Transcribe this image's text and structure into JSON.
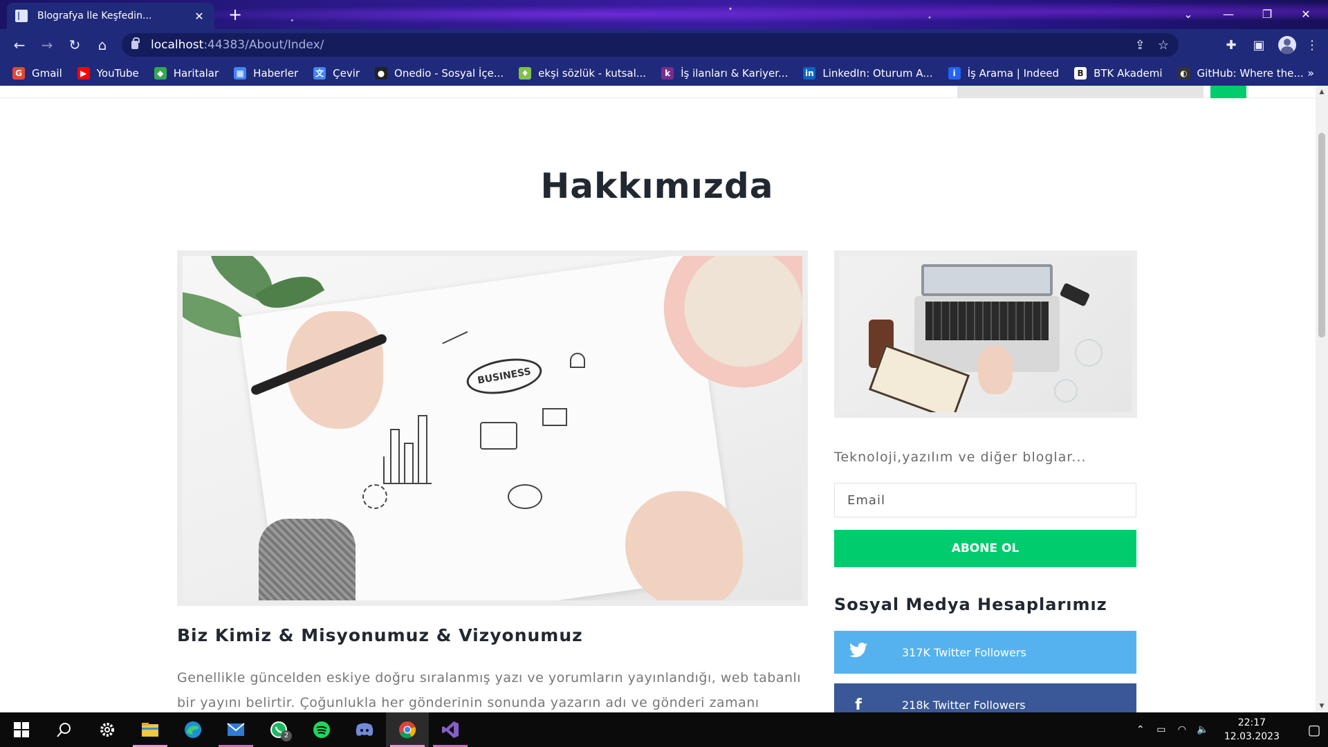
{
  "browser": {
    "tab_title": "Blografya İle Keşfedin...",
    "tab_close": "✕",
    "new_tab": "+",
    "url_host": "localhost",
    "url_rest": ":44383/About/Index/",
    "bookmarks": [
      {
        "label": "Gmail",
        "icon": "G",
        "color": "#ea4335"
      },
      {
        "label": "YouTube",
        "icon": "▶",
        "color": "#ff0000"
      },
      {
        "label": "Haritalar",
        "icon": "◆",
        "color": "#34a853"
      },
      {
        "label": "Haberler",
        "icon": "▦",
        "color": "#4285f4"
      },
      {
        "label": "Çevir",
        "icon": "文",
        "color": "#4285f4"
      },
      {
        "label": "Onedio - Sosyal İçe...",
        "icon": "●",
        "color": "#222222"
      },
      {
        "label": "ekşi sözlük - kutsal...",
        "icon": "♦",
        "color": "#81c14b"
      },
      {
        "label": "İş ilanları & Kariyer...",
        "icon": "k",
        "color": "#7b2c8e"
      },
      {
        "label": "LinkedIn: Oturum A...",
        "icon": "in",
        "color": "#0a66c2"
      },
      {
        "label": "İş Arama | Indeed",
        "icon": "i",
        "color": "#2164f3"
      },
      {
        "label": "BTK Akademi",
        "icon": "B",
        "color": "#ffffff"
      },
      {
        "label": "GitHub: Where the...",
        "icon": "◐",
        "color": "#333333"
      }
    ],
    "more": "»"
  },
  "page": {
    "title": "Hakkımızda",
    "tagline": "Teknoloji,yazılım ve diğer bloglar...",
    "email_placeholder": "Email",
    "subscribe_label": "ABONE OL",
    "social_title": "Sosyal Medya Hesaplarımız",
    "social": [
      {
        "label": "317K Twitter Followers",
        "icon": "twitter-icon",
        "color": "#55b2ee"
      },
      {
        "label": "218k Twitter Followers",
        "icon": "facebook-icon",
        "color": "#3a5897"
      }
    ],
    "section_title": "Biz Kimiz & Misyonumuz & Vizyonumuz",
    "body_text": "Genellikle güncelden eskiye doğru sıralanmış yazı ve yorumların yayınlandığı, web tabanlı bir yayını belirtir. Çoğunlukla her gönderinin sonunda yazarın adı ve gönderi zamanı",
    "business_label": "BUSINESS",
    "accent_color": "#00cc6e"
  },
  "taskbar": {
    "whatsapp_badge": "2",
    "time": "22:17",
    "date": "12.03.2023"
  }
}
